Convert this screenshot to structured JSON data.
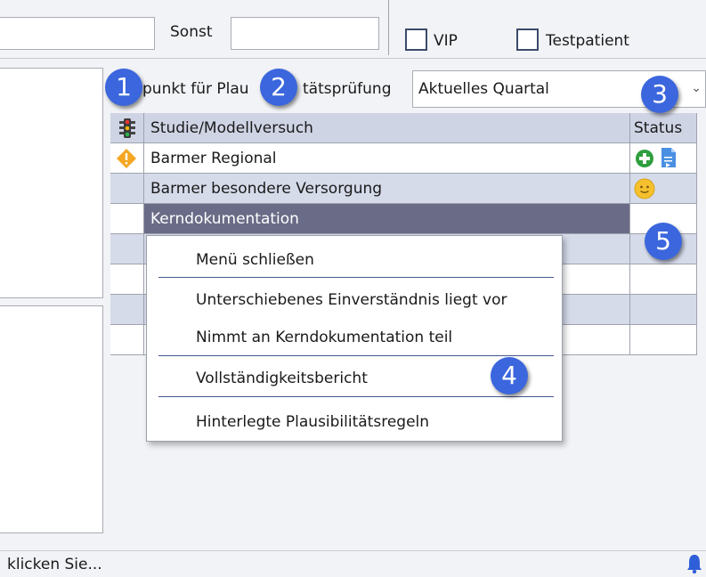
{
  "top": {
    "sonst_label": "Sonst",
    "vip_label": "VIP",
    "testpatient_label": "Testpatient"
  },
  "plausi": {
    "label_left": "punkt für Plau",
    "label_right": "tätsprüfung",
    "selected": "Aktuelles Quartal"
  },
  "table": {
    "headers": {
      "study": "Studie/Modellversuch",
      "status": "Status"
    },
    "rows": [
      {
        "name": "Barmer Regional",
        "has_warning": true,
        "status": "add-and-document"
      },
      {
        "name": "Barmer besondere Versorgung",
        "has_warning": false,
        "status": "smiley"
      },
      {
        "name": "Kerndokumentation",
        "has_warning": false,
        "status": "",
        "selected": true
      },
      {
        "name": "",
        "status": ""
      },
      {
        "name": "",
        "status": ""
      },
      {
        "name": "",
        "status": ""
      },
      {
        "name": "",
        "status": ""
      }
    ]
  },
  "context_menu": {
    "items": [
      "Menü schließen",
      "Unterschiebenes Einverständnis liegt vor",
      "Nimmt an Kerndokumentation teil",
      "Vollständigkeitsbericht",
      "Hinterlegte Plausibilitätsregeln"
    ]
  },
  "badges": [
    "1",
    "2",
    "3",
    "4",
    "5"
  ],
  "status_bar": {
    "text": "klicken Sie..."
  },
  "colors": {
    "badge": "#3b66dd",
    "selected_row": "#6a6c87",
    "alt_row": "#d6dbea",
    "warning": "#f5a623",
    "plus_green": "#2e9e3e"
  },
  "icons": [
    "traffic-light-icon",
    "warning-icon",
    "add-icon",
    "document-icon",
    "smiley-icon",
    "bell-icon",
    "chevron-down-icon"
  ]
}
